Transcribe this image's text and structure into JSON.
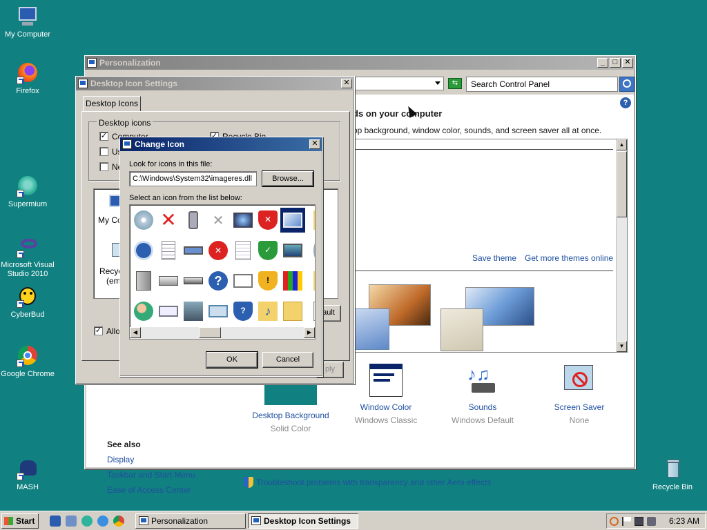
{
  "desktop": {
    "icons": [
      {
        "label": "My Computer",
        "icon": "my-computer-icon"
      },
      {
        "label": "Firefox",
        "icon": "firefox-icon"
      },
      {
        "label": "Supermium",
        "icon": "supermium-icon"
      },
      {
        "label": "Microsoft Visual Studio 2010",
        "icon": "visual-studio-icon"
      },
      {
        "label": "CyberBud",
        "icon": "cyberbud-icon"
      },
      {
        "label": "Google Chrome",
        "icon": "chrome-icon"
      },
      {
        "label": "MASH",
        "icon": "mash-icon"
      },
      {
        "label": "Recycle Bin",
        "icon": "recycle-bin-icon"
      }
    ],
    "background": "#118080"
  },
  "personalization": {
    "title": "Personalization",
    "search_placeholder": "Search Control Panel",
    "heading": "ds on your computer",
    "subheading": "op background, window color, sounds, and screen saver all at once.",
    "save_theme": "Save theme",
    "more_themes": "Get more themes online",
    "categories": [
      {
        "title": "Desktop Background",
        "value": "Solid Color"
      },
      {
        "title": "Window Color",
        "value": "Windows Classic"
      },
      {
        "title": "Sounds",
        "value": "Windows Default"
      },
      {
        "title": "Screen Saver",
        "value": "None"
      }
    ],
    "see_also": {
      "heading": "See also",
      "links": [
        "Display",
        "Taskbar and Start Menu",
        "Ease of Access Center"
      ]
    },
    "troubleshoot": "Troubleshoot problems with transparency and other Aero effects"
  },
  "desktop_icon_settings": {
    "title": "Desktop Icon Settings",
    "tab": "Desktop Icons",
    "group_label": "Desktop icons",
    "checkboxes": [
      {
        "label": "Computer",
        "checked": true
      },
      {
        "label": "Us",
        "checked": false
      },
      {
        "label": "Ne",
        "checked": false
      },
      {
        "label": "Recycle Bin",
        "checked": true
      }
    ],
    "list_labels": [
      "My Co",
      "Recyc",
      "(emp"
    ],
    "allow_label": "Allow",
    "restore_default_fragment": "ault",
    "apply_fragment": "ply"
  },
  "change_icon": {
    "title": "Change Icon",
    "file_label": "Look for icons in this file:",
    "file_path": "C:\\Windows\\System32\\imageres.dll",
    "browse": "Browse...",
    "list_label": "Select an icon from the list below:",
    "ok": "OK",
    "cancel": "Cancel"
  },
  "taskbar": {
    "start": "Start",
    "tasks": [
      {
        "label": "Personalization",
        "active": false
      },
      {
        "label": "Desktop Icon Settings",
        "active": true
      }
    ],
    "clock": "6:23 AM"
  }
}
